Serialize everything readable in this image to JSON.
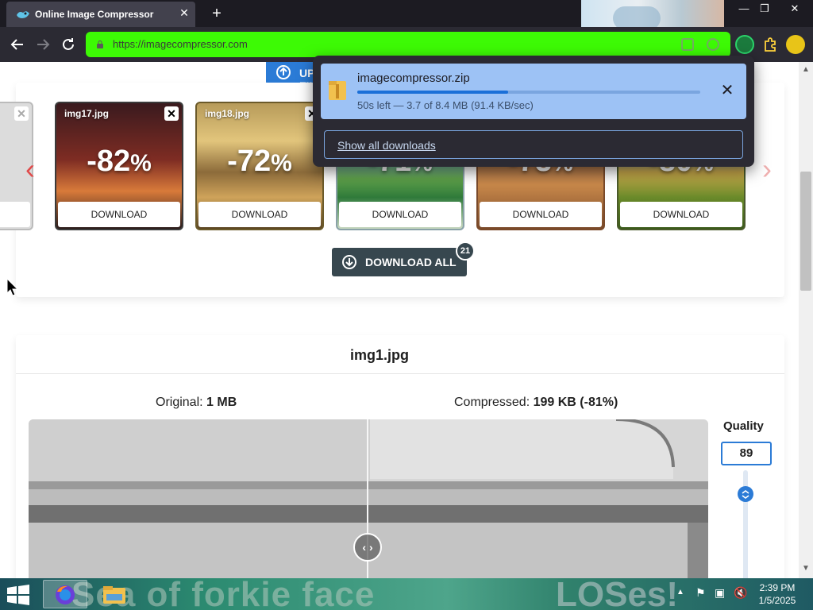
{
  "browser": {
    "tab_title": "Online Image Compressor",
    "tab_close": "✕",
    "new_tab": "+",
    "url": "https://imagecompressor.com",
    "window_controls": {
      "minimize": "—",
      "restore": "❐",
      "close": "✕"
    },
    "url_bar_color": "#3dfa05"
  },
  "gallery": {
    "upload_label": "UPLOAD FILES",
    "download_label": "DOWNLOAD",
    "download_all_label": "DOWNLOAD ALL",
    "download_all_count": "21",
    "items": [
      {
        "name": "",
        "percent": "",
        "partial": true
      },
      {
        "name": "img17.jpg",
        "percent": "-82",
        "percent_symbol": "%"
      },
      {
        "name": "img18.jpg",
        "percent": "-72",
        "percent_symbol": "%"
      },
      {
        "name": "",
        "percent": "-71",
        "percent_symbol": "%"
      },
      {
        "name": "",
        "percent": "-73",
        "percent_symbol": "%"
      },
      {
        "name": "",
        "percent": "-80",
        "percent_symbol": "%"
      }
    ]
  },
  "compare": {
    "file_name": "img1.jpg",
    "original_label": "Original: ",
    "original_size": "1 MB",
    "compressed_label": "Compressed: ",
    "compressed_size": "199 KB",
    "compressed_pct": "(-81%)",
    "quality_label": "Quality",
    "quality_value": "89",
    "quality_level": 0.89,
    "slider_handle": "‹ ›"
  },
  "downloads_panel": {
    "file_name": "imagecompressor.zip",
    "status": "50s left — 3.7 of 8.4 MB (91.4 KB/sec)",
    "progress": 0.44,
    "show_all_label": "Show all downloads"
  },
  "taskbar": {
    "wallpaper_text_left": "Sea of forkie face",
    "wallpaper_text_right": "LOSes!",
    "clock_time": "2:39 PM",
    "clock_date": "1/5/2025"
  },
  "colors": {
    "accent_blue": "#2b7bd6",
    "dark_button": "#37474f",
    "carousel_arrow": "#e04b4b"
  }
}
